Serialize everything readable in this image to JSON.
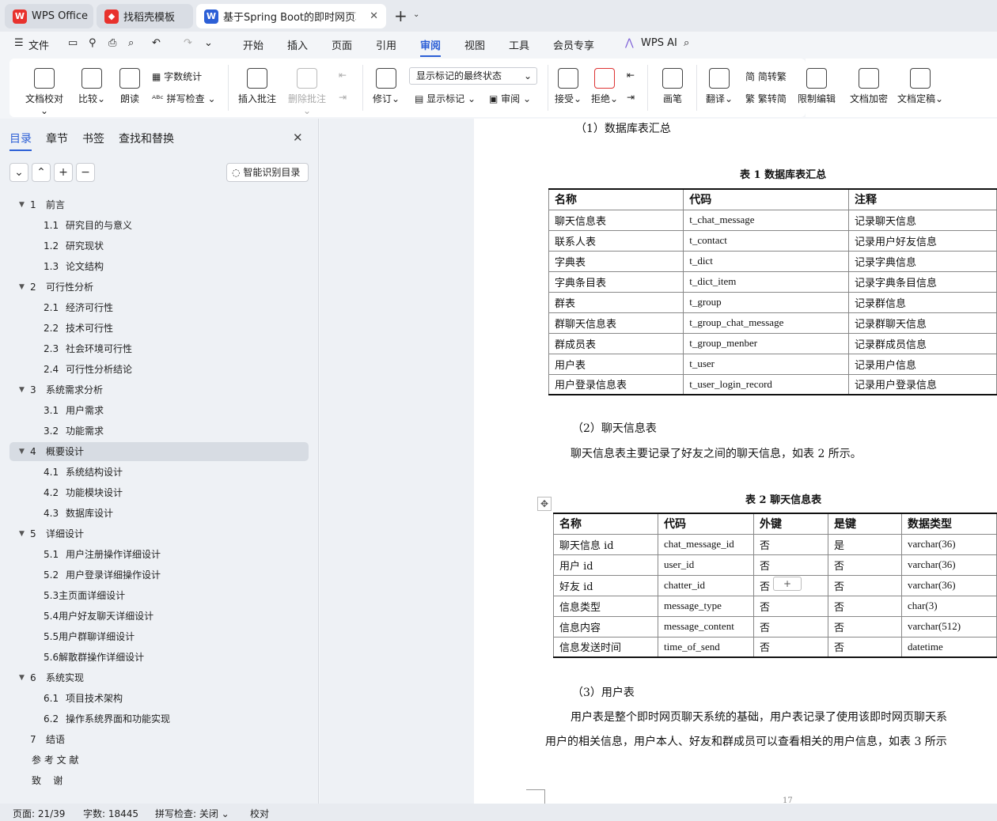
{
  "tabs": [
    {
      "label": "WPS Office"
    },
    {
      "label": "找稻壳模板"
    },
    {
      "label": "基于Spring Boot的即时网页聊"
    }
  ],
  "menu": {
    "file": "文件",
    "items": [
      "开始",
      "插入",
      "页面",
      "引用",
      "审阅",
      "视图",
      "工具",
      "会员专享"
    ],
    "ai": "WPS AI"
  },
  "ribbon": {
    "doc_check": "文档校对",
    "compare": "比较",
    "read": "朗读",
    "word_count": "字数统计",
    "spell_check": "拼写检查",
    "insert_comment": "插入批注",
    "delete_comment": "删除批注",
    "revise": "修订",
    "markup_select": "显示标记的最终状态",
    "show_markup": "显示标记",
    "review": "审阅",
    "accept": "接受",
    "reject": "拒绝",
    "pen": "画笔",
    "translate": "翻译",
    "to_traditional": "简转繁",
    "to_simplified": "繁转简",
    "restrict_edit": "限制编辑",
    "encrypt": "文档加密",
    "finalize": "文档定稿"
  },
  "nav": {
    "tabs": [
      "目录",
      "章节",
      "书签",
      "查找和替换"
    ],
    "smart_button": "智能识别目录",
    "toc": [
      {
        "num": "1",
        "text": "前言",
        "level": 1,
        "expanded": true
      },
      {
        "num": "1.1",
        "text": "研究目的与意义",
        "level": 2
      },
      {
        "num": "1.2",
        "text": "研究现状",
        "level": 2
      },
      {
        "num": "1.3",
        "text": "论文结构",
        "level": 2
      },
      {
        "num": "2",
        "text": "可行性分析",
        "level": 1,
        "expanded": true
      },
      {
        "num": "2.1",
        "text": "经济可行性",
        "level": 2
      },
      {
        "num": "2.2",
        "text": "技术可行性",
        "level": 2
      },
      {
        "num": "2.3",
        "text": "社会环境可行性",
        "level": 2
      },
      {
        "num": "2.4",
        "text": "可行性分析结论",
        "level": 2
      },
      {
        "num": "3",
        "text": "系统需求分析",
        "level": 1,
        "expanded": true
      },
      {
        "num": "3.1",
        "text": "用户需求",
        "level": 2
      },
      {
        "num": "3.2",
        "text": "功能需求",
        "level": 2
      },
      {
        "num": "4",
        "text": "概要设计",
        "level": 1,
        "expanded": true,
        "selected": true
      },
      {
        "num": "4.1",
        "text": "系统结构设计",
        "level": 2
      },
      {
        "num": "4.2",
        "text": "功能模块设计",
        "level": 2
      },
      {
        "num": "4.3",
        "text": "数据库设计",
        "level": 2
      },
      {
        "num": "5",
        "text": "详细设计",
        "level": 1,
        "expanded": true
      },
      {
        "num": "5.1",
        "text": "用户注册操作详细设计",
        "level": 2
      },
      {
        "num": "5.2",
        "text": "用户登录详细操作设计",
        "level": 2
      },
      {
        "num": "",
        "text": "5.3主页面详细设计",
        "level": 2
      },
      {
        "num": "",
        "text": "5.4用户好友聊天详细设计",
        "level": 2
      },
      {
        "num": "",
        "text": "5.5用户群聊详细设计",
        "level": 2
      },
      {
        "num": "",
        "text": "5.6解散群操作详细设计",
        "level": 2
      },
      {
        "num": "6",
        "text": "系统实现",
        "level": 1,
        "expanded": true
      },
      {
        "num": "6.1",
        "text": "项目技术架构",
        "level": 2
      },
      {
        "num": "6.2",
        "text": "操作系统界面和功能实现",
        "level": 2
      },
      {
        "num": "7",
        "text": "结语",
        "level": 1
      },
      {
        "num": "",
        "text": "参 考 文 献",
        "level": 0
      },
      {
        "num": "",
        "text": "致    谢",
        "level": 0
      }
    ]
  },
  "doc": {
    "h1": "（1）数据库表汇总",
    "table1_caption": "表 1  数据库表汇总",
    "table1": {
      "headers": [
        "名称",
        "代码",
        "注释"
      ],
      "rows": [
        [
          "聊天信息表",
          "t_chat_message",
          "记录聊天信息"
        ],
        [
          "联系人表",
          "t_contact",
          "记录用户好友信息"
        ],
        [
          "字典表",
          "t_dict",
          "记录字典信息"
        ],
        [
          "字典条目表",
          "t_dict_item",
          "记录字典条目信息"
        ],
        [
          "群表",
          "t_group",
          "记录群信息"
        ],
        [
          "群聊天信息表",
          "t_group_chat_message",
          "记录群聊天信息"
        ],
        [
          "群成员表",
          "t_group_menber",
          "记录群成员信息"
        ],
        [
          "用户表",
          "t_user",
          "记录用户信息"
        ],
        [
          "用户登录信息表",
          "t_user_login_record",
          "记录用户登录信息"
        ]
      ]
    },
    "h2": "（2）聊天信息表",
    "p2": "聊天信息表主要记录了好友之间的聊天信息，如表 2 所示。",
    "table2_caption": "表 2  聊天信息表",
    "table2": {
      "headers": [
        "名称",
        "代码",
        "外键",
        "是键",
        "数据类型"
      ],
      "rows": [
        [
          "聊天信息 id",
          "chat_message_id",
          "否",
          "是",
          "varchar(36)"
        ],
        [
          "用户 id",
          "user_id",
          "否",
          "否",
          "varchar(36)"
        ],
        [
          "好友 id",
          "chatter_id",
          "否",
          "否",
          "varchar(36)"
        ],
        [
          "信息类型",
          "message_type",
          "否",
          "否",
          "char(3)"
        ],
        [
          "信息内容",
          "message_content",
          "否",
          "否",
          "varchar(512)"
        ],
        [
          "信息发送时间",
          "time_of_send",
          "否",
          "否",
          "datetime"
        ]
      ]
    },
    "h3": "（3）用户表",
    "p3a": "用户表是整个即时网页聊天系统的基础，用户表记录了使用该即时网页聊天系",
    "p3b": "用户的相关信息，用户本人、好友和群成员可以查看相关的用户信息，如表 3 所示",
    "page_num": "17"
  },
  "status": {
    "page": "页面: 21/39",
    "words": "字数: 18445",
    "spell": "拼写检查: 关闭",
    "proof": "校对"
  }
}
